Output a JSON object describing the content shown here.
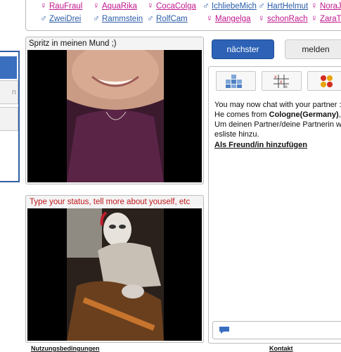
{
  "users": [
    {
      "name": "RauFraul",
      "gender": "f"
    },
    {
      "name": "AquaRika",
      "gender": "f"
    },
    {
      "name": "CocaColga",
      "gender": "f"
    },
    {
      "name": "IchliebeMich",
      "gender": "m"
    },
    {
      "name": "HartHelmut",
      "gender": "m"
    },
    {
      "name": "NoraJ",
      "gender": "f"
    },
    {
      "name": "ZweiDrei",
      "gender": "m"
    },
    {
      "name": "Rammstein",
      "gender": "m"
    },
    {
      "name": "RolfCam",
      "gender": "m"
    },
    {
      "name": "Mangelga",
      "gender": "f"
    },
    {
      "name": "schonRach",
      "gender": "f"
    },
    {
      "name": "ZaraT",
      "gender": "f"
    }
  ],
  "sidebar": {
    "item_fragment": "n"
  },
  "partner_video": {
    "status": "Spritz in meinen Mund ;)"
  },
  "own_video": {
    "status_placeholder": "Type your status, tell more about youself, etc"
  },
  "buttons": {
    "next": "nächster",
    "report": "melden"
  },
  "chat": {
    "line1": "You may now chat with your partner :",
    "line2_prefix": "He comes from ",
    "line2_city": "Cologne(Germany)",
    "line2_suffix": ",",
    "line3": "Um deinen Partner/deine Partnerin wi",
    "line4": "esliste hinzu.",
    "add_friend": "Als Freund/in hinzufügen",
    "input_placeholder": ""
  },
  "footer": {
    "terms": "Nutzungsbedingungen",
    "contact": "Kontakt"
  },
  "colors": {
    "accent": "#2d62b6",
    "female": "#c0178e",
    "male": "#2a5ca8",
    "status_red": "#c0181c"
  }
}
